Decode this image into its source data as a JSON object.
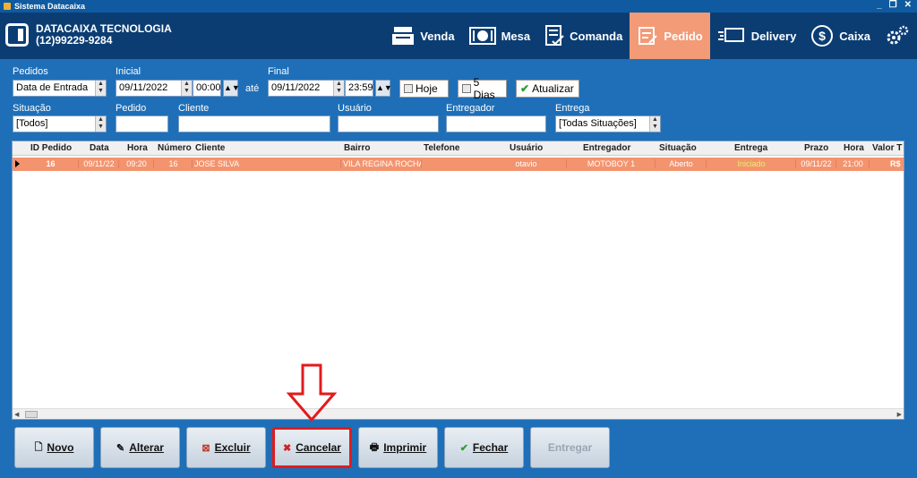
{
  "window": {
    "title": "Sistema Datacaixa",
    "controls": [
      "_",
      "❐",
      "✕"
    ]
  },
  "brand": {
    "name": "DATACAIXA TECNOLOGIA",
    "phone": "(12)99229-9284"
  },
  "nav": [
    {
      "label": "Venda",
      "icon": "cash-register-icon"
    },
    {
      "label": "Mesa",
      "icon": "table-icon"
    },
    {
      "label": "Comanda",
      "icon": "checklist-icon"
    },
    {
      "label": "Pedido",
      "icon": "order-icon",
      "active": true
    },
    {
      "label": "Delivery",
      "icon": "delivery-truck-icon"
    },
    {
      "label": "Caixa",
      "icon": "dollar-icon"
    },
    {
      "label": "",
      "icon": "gears-icon"
    }
  ],
  "filters": {
    "pedidos_label": "Pedidos",
    "pedidos_value": "Data de Entrada",
    "inicial_label": "Inicial",
    "inicial_date": "09/11/2022",
    "inicial_time": "00:00",
    "ate_label": "até",
    "final_label": "Final",
    "final_date": "09/11/2022",
    "final_time": "23:59",
    "hoje": "Hoje",
    "cinco_dias": "5 Dias",
    "atualizar": "Atualizar",
    "situacao_label": "Situação",
    "situacao_value": "[Todos]",
    "pedido_label": "Pedido",
    "pedido_value": "",
    "cliente_label": "Cliente",
    "cliente_value": "",
    "usuario_label": "Usuário",
    "usuario_value": "",
    "entregador_label": "Entregador",
    "entregador_value": "",
    "entrega_label": "Entrega",
    "entrega_value": "[Todas Situações]"
  },
  "grid": {
    "columns": [
      "ID Pedido",
      "Data",
      "Hora",
      "Número",
      "Cliente",
      "Bairro",
      "Telefone",
      "Usuário",
      "Entregador",
      "Situação",
      "Entrega",
      "Prazo",
      "Hora",
      "Valor T"
    ],
    "rows": [
      [
        "16",
        "09/11/22",
        "09:20",
        "16",
        "JOSE SILVA",
        "VILA REGINA ROCHA",
        "",
        "otavio",
        "MOTOBOY 1",
        "Aberto",
        "Iniciado",
        "09/11/22",
        "21:00",
        "R$"
      ]
    ]
  },
  "buttons": {
    "novo": "Novo",
    "alterar": "Alterar",
    "excluir": "Excluir",
    "cancelar": "Cancelar",
    "imprimir": "Imprimir",
    "fechar": "Fechar",
    "entregar": "Entregar"
  },
  "colors": {
    "header": "#0b3d73",
    "accent": "#f39a77",
    "background": "#1e6fb8",
    "highlight": "#e11b1b"
  }
}
